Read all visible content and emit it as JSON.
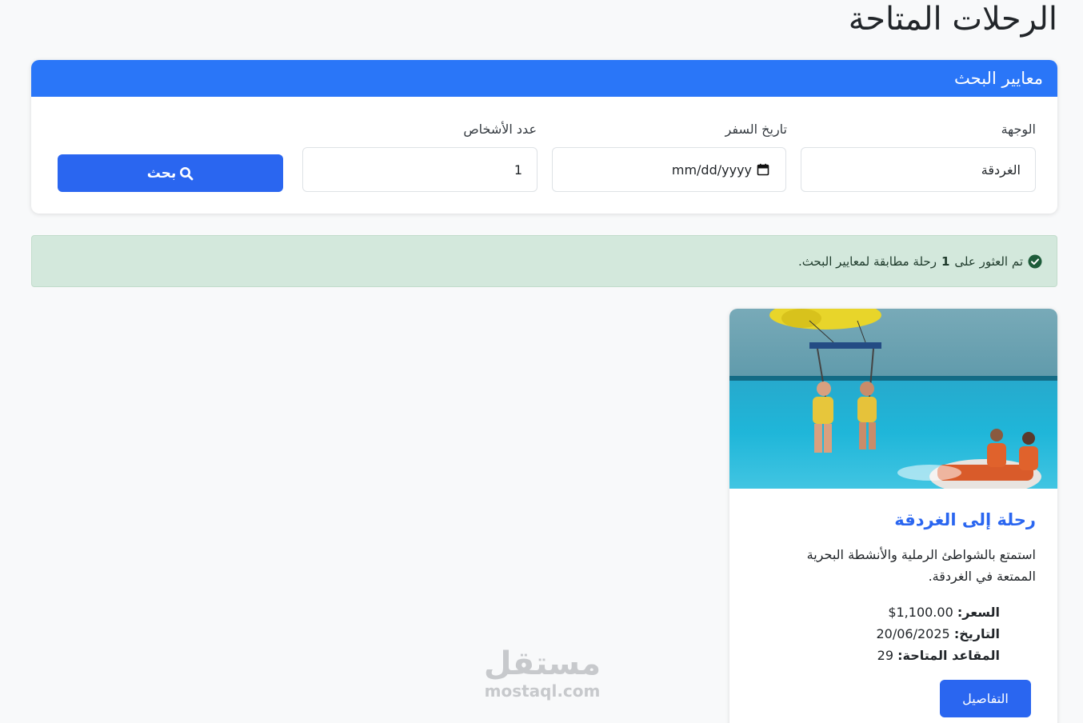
{
  "page": {
    "title": "الرحلات المتاحة"
  },
  "search": {
    "header": "معايير البحث",
    "destination_label": "الوجهة",
    "destination_value": "الغردقة",
    "date_label": "تاريخ السفر",
    "date_placeholder": "mm/dd/yyyy",
    "persons_label": "عدد الأشخاص",
    "persons_value": "1",
    "search_button": "بحث",
    "search_icon": "search-icon",
    "calendar_icon": "calendar-icon"
  },
  "alert": {
    "icon": "check-circle-icon",
    "text_before": "تم العثور على",
    "count": "1",
    "text_after": "رحلة مطابقة لمعايير البحث."
  },
  "trip": {
    "image_alt": "parasailing-and-jet-ski-photo",
    "title": "رحلة إلى الغردقة",
    "description": "استمتع بالشواطئ الرملية والأنشطة البحرية الممتعة في الغردقة.",
    "price_label": "السعر:",
    "price_value": "1,100.00$",
    "date_label": "التاريخ:",
    "date_value": "20/06/2025",
    "seats_label": "المقاعد المتاحة:",
    "seats_value": "29",
    "details_button": "التفاصيل"
  },
  "watermark": {
    "arabic": "مستقل",
    "latin": "mostaql.com"
  },
  "colors": {
    "primary": "#2a76f8",
    "button": "#2a66f0",
    "alert_bg": "#d3e8dc",
    "alert_icon": "#1e5c3a"
  }
}
